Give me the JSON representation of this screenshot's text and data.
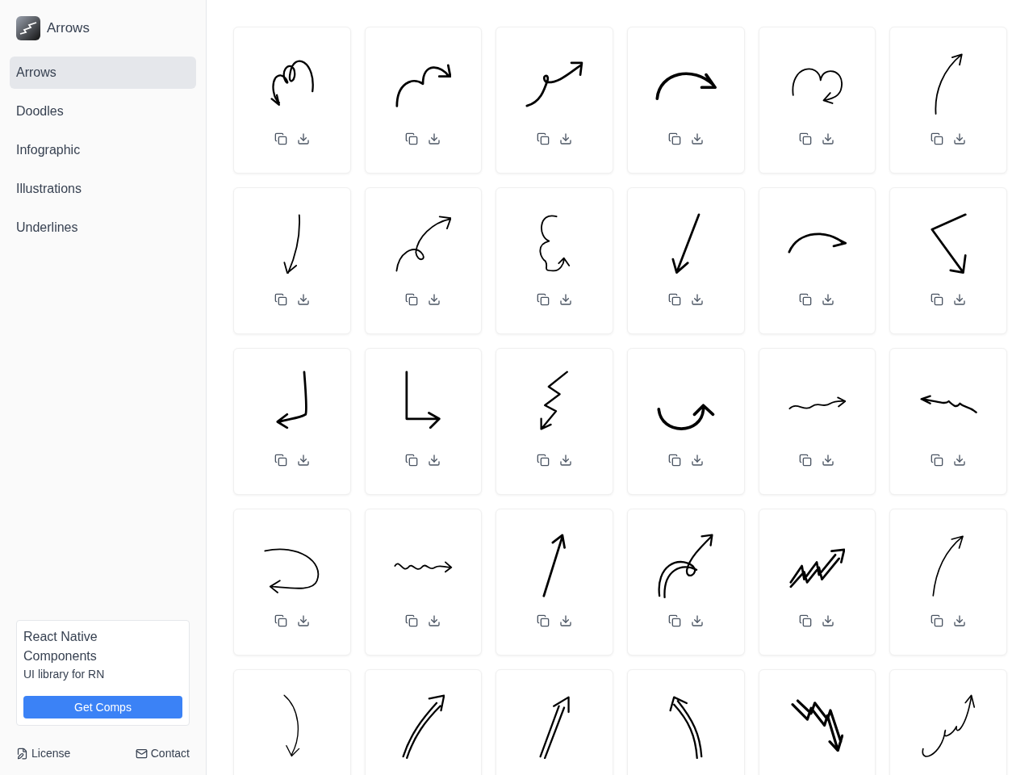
{
  "app": {
    "title": "Arrows"
  },
  "sidebar": {
    "items": [
      {
        "label": "Arrows",
        "selected": true
      },
      {
        "label": "Doodles",
        "selected": false
      },
      {
        "label": "Infographic",
        "selected": false
      },
      {
        "label": "Illustrations",
        "selected": false
      },
      {
        "label": "Underlines",
        "selected": false
      }
    ]
  },
  "promo": {
    "title": "React Native Components",
    "subtitle": "UI library for RN",
    "button": "Get Comps"
  },
  "footer": {
    "license": "License",
    "contact": "Contact"
  },
  "gallery": [
    {
      "kind": "spiral"
    },
    {
      "kind": "hop"
    },
    {
      "kind": "squiggle"
    },
    {
      "kind": "arc"
    },
    {
      "kind": "cloud"
    },
    {
      "kind": "thin-up"
    },
    {
      "kind": "thin-down"
    },
    {
      "kind": "loop-up"
    },
    {
      "kind": "curly-down"
    },
    {
      "kind": "straight-down"
    },
    {
      "kind": "arc-small"
    },
    {
      "kind": "corner"
    },
    {
      "kind": "hook-left"
    },
    {
      "kind": "l-right"
    },
    {
      "kind": "zigzag-down"
    },
    {
      "kind": "u-turn"
    },
    {
      "kind": "wave-right"
    },
    {
      "kind": "wave-left"
    },
    {
      "kind": "loop-back"
    },
    {
      "kind": "wave-small"
    },
    {
      "kind": "straight-up"
    },
    {
      "kind": "double-loop"
    },
    {
      "kind": "zigzag-up"
    },
    {
      "kind": "thin-curve"
    },
    {
      "kind": "thin-fall"
    },
    {
      "kind": "double-up"
    },
    {
      "kind": "double-straight"
    },
    {
      "kind": "double-left"
    },
    {
      "kind": "zigzag-bold"
    },
    {
      "kind": "scribble-up"
    }
  ]
}
